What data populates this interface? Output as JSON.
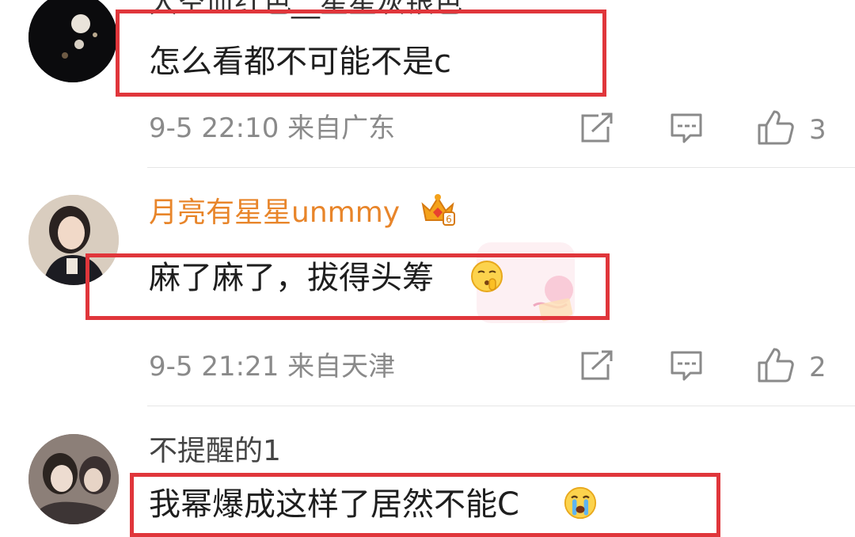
{
  "comments": [
    {
      "username": "大空血红色__星星灰银色",
      "text": "怎么看都不可能不是c",
      "time": "9-5 22:10",
      "location": "来自广东",
      "likes": "3"
    },
    {
      "username": "月亮有星星unmmy",
      "text": "麻了麻了，拔得头筹",
      "time": "9-5 21:21",
      "location": "来自天津",
      "likes": "2"
    },
    {
      "username": "不提醒的1",
      "text": "我幂爆成这样了居然不能C"
    }
  ],
  "colors": {
    "highlight_box": "#e0363b",
    "vip_username": "#e8852a",
    "meta_text": "#8a8a8a"
  },
  "icons": [
    "repost-icon",
    "comment-icon",
    "like-icon",
    "crown-badge-icon",
    "shush-emoji-icon",
    "crying-emoji-icon"
  ]
}
